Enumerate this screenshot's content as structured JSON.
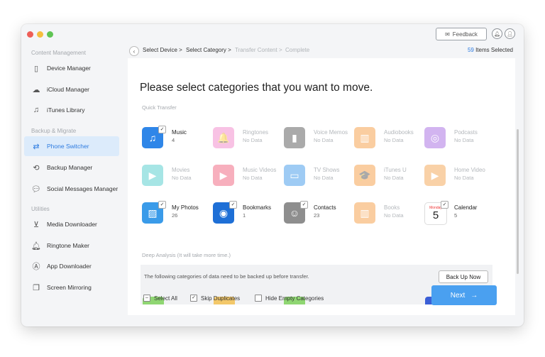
{
  "titlebar": {
    "feedback_label": "Feedback",
    "feedback_icon": "envelope-icon",
    "notification_icon": "bell-icon",
    "account_icon": "user-icon"
  },
  "sidebar": {
    "sections": [
      "Content Management",
      "Backup & Migrate",
      "Utilities"
    ],
    "items": [
      {
        "label": "Device Manager",
        "icon": "phone-icon"
      },
      {
        "label": "iCloud Manager",
        "icon": "cloud-icon"
      },
      {
        "label": "iTunes Library",
        "icon": "music-library-icon"
      },
      {
        "label": "Phone Switcher",
        "icon": "phone-switch-icon"
      },
      {
        "label": "Backup Manager",
        "icon": "backup-clock-icon"
      },
      {
        "label": "Social Messages Manager",
        "icon": "chat-bubbles-icon"
      },
      {
        "label": "Media Downloader",
        "icon": "download-icon"
      },
      {
        "label": "Ringtone Maker",
        "icon": "bell-icon"
      },
      {
        "label": "App Downloader",
        "icon": "app-store-icon"
      },
      {
        "label": "Screen Mirroring",
        "icon": "screen-mirror-icon"
      }
    ],
    "active": "Phone Switcher",
    "collapse_glyph": "‹"
  },
  "breadcrumb": {
    "steps": [
      "Select Device >",
      "Select Category >",
      "Transfer Content >",
      "Complete"
    ],
    "current_count": "59",
    "selected_suffix": "Items Selected"
  },
  "main": {
    "heading": "Please select categories that you want to move.",
    "quick_label": "Quick Transfer",
    "deep_label": "Deep Analysis (It will take more time.)",
    "deep_message": "The following categories of data need to be backed up before transfer.",
    "backup_button": "Back Up Now"
  },
  "categories": [
    {
      "name": "Music",
      "sub": "4",
      "checked": true,
      "color": "#2f86e8",
      "glyph": "♫"
    },
    {
      "name": "Ringtones",
      "sub": "No Data",
      "checked": false,
      "color": "#f07ac4",
      "glyph": "🔔"
    },
    {
      "name": "Voice Memos",
      "sub": "No Data",
      "checked": false,
      "color": "#444444",
      "glyph": "▮"
    },
    {
      "name": "Audiobooks",
      "sub": "No Data",
      "checked": false,
      "color": "#f5922e",
      "glyph": "▥"
    },
    {
      "name": "Podcasts",
      "sub": "No Data",
      "checked": false,
      "color": "#9c5be0",
      "glyph": "◎"
    },
    {
      "name": "Movies",
      "sub": "No Data",
      "checked": false,
      "color": "#3cc6c6",
      "glyph": "▶"
    },
    {
      "name": "Music Videos",
      "sub": "No Data",
      "checked": false,
      "color": "#ef4f6e",
      "glyph": "▶"
    },
    {
      "name": "TV Shows",
      "sub": "No Data",
      "checked": false,
      "color": "#2a8ee8",
      "glyph": "▭"
    },
    {
      "name": "iTunes U",
      "sub": "No Data",
      "checked": false,
      "color": "#f5922e",
      "glyph": "🎓"
    },
    {
      "name": "Home Video",
      "sub": "No Data",
      "checked": false,
      "color": "#f39a3e",
      "glyph": "▶"
    },
    {
      "name": "My Photos",
      "sub": "26",
      "checked": true,
      "color": "#3a9be9",
      "glyph": "▨"
    },
    {
      "name": "Bookmarks",
      "sub": "1",
      "checked": true,
      "color": "#1e6fd6",
      "glyph": "◉"
    },
    {
      "name": "Contacts",
      "sub": "23",
      "checked": true,
      "color": "#8e8e8e",
      "glyph": "☺"
    },
    {
      "name": "Books",
      "sub": "No Data",
      "checked": false,
      "color": "#f5922e",
      "glyph": "▥"
    },
    {
      "name": "Calendar",
      "sub": "5",
      "checked": true,
      "color": "#ffffff",
      "glyph": "5",
      "cal_day": "Monday"
    }
  ],
  "footer": {
    "select_all": "Select All",
    "skip_duplicates": "Skip Duplicates",
    "hide_empty": "Hide Empty Categories",
    "next_label": "Next",
    "next_arrow": "→"
  }
}
